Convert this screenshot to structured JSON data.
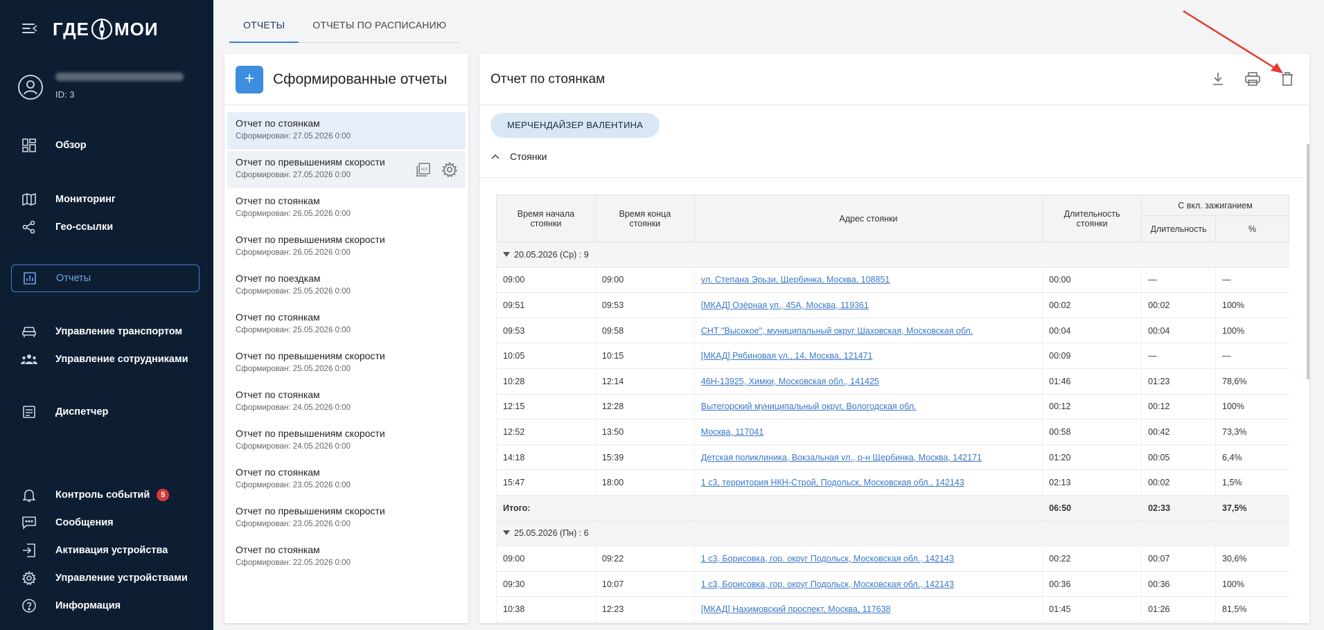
{
  "sidebar": {
    "logo": {
      "left": "ГДЕ",
      "right": "МОИ"
    },
    "user_id": "ID: 3",
    "nav": [
      {
        "label": "Обзор",
        "icon": "dashboard-icon"
      },
      {
        "label": "Мониторинг",
        "icon": "map-icon"
      },
      {
        "label": "Гео-ссылки",
        "icon": "share-icon"
      },
      {
        "label": "Отчеты",
        "icon": "chart-icon"
      },
      {
        "label": "Управление транспортом",
        "icon": "car-icon"
      },
      {
        "label": "Управление сотрудниками",
        "icon": "people-icon"
      },
      {
        "label": "Диспетчер",
        "icon": "dispatcher-icon"
      },
      {
        "label": "Контроль событий",
        "icon": "bell-icon",
        "badge": "5"
      },
      {
        "label": "Сообщения",
        "icon": "message-icon"
      },
      {
        "label": "Активация устройства",
        "icon": "login-icon"
      },
      {
        "label": "Управление устройствами",
        "icon": "gear-icon"
      },
      {
        "label": "Информация",
        "icon": "help-icon"
      }
    ]
  },
  "tabs": [
    {
      "label": "ОТЧЕТЫ"
    },
    {
      "label": "ОТЧЕТЫ ПО РАСПИСАНИЮ"
    }
  ],
  "list": {
    "add_label": "+",
    "title": "Сформированные отчеты",
    "items": [
      {
        "name": "Отчет по стоянкам",
        "date": "Сформирован: 27.05.2026 0:00"
      },
      {
        "name": "Отчет по превышениям скорости",
        "date": "Сформирован: 27.05.2026 0:00"
      },
      {
        "name": "Отчет по стоянкам",
        "date": "Сформирован: 26.05.2026 0:00"
      },
      {
        "name": "Отчет по превышениям скорости",
        "date": "Сформирован: 26.05.2026 0:00"
      },
      {
        "name": "Отчет по поездкам",
        "date": "Сформирован: 25.05.2026 0:00"
      },
      {
        "name": "Отчет по стоянкам",
        "date": "Сформирован: 25.05.2026 0:00"
      },
      {
        "name": "Отчет по превышениям скорости",
        "date": "Сформирован: 25.05.2026 0:00"
      },
      {
        "name": "Отчет по стоянкам",
        "date": "Сформирован: 24.05.2026 0:00"
      },
      {
        "name": "Отчет по превышениям скорости",
        "date": "Сформирован: 24.05.2026 0:00"
      },
      {
        "name": "Отчет по стоянкам",
        "date": "Сформирован: 23.05.2026 0:00"
      },
      {
        "name": "Отчет по превышениям скорости",
        "date": "Сформирован: 23.05.2026 0:00"
      },
      {
        "name": "Отчет по стоянкам",
        "date": "Сформирован: 22.05.2026 0:00"
      }
    ]
  },
  "detail": {
    "title": "Отчет по стоянкам",
    "chip": "МЕРЧЕНДАЙЗЕР ВАЛЕНТИНА",
    "section": "Стоянки",
    "headers": {
      "start": "Время начала стоянки",
      "end": "Время конца стоянки",
      "address": "Адрес стоянки",
      "duration": "Длительность стоянки",
      "ignition_group": "С вкл. зажиганием",
      "ign_duration": "Длительность",
      "ign_pct": "%"
    },
    "groups": [
      {
        "label": "20.05.2026 (Ср) : 9",
        "rows": [
          [
            "09:00",
            "09:00",
            "ул. Степана Эрьзи, Щербинка, Москва, 108851",
            "00:00",
            "—",
            "—"
          ],
          [
            "09:51",
            "09:53",
            "[МКАД] Озёрная ул., 45А, Москва, 119361",
            "00:02",
            "00:02",
            "100%"
          ],
          [
            "09:53",
            "09:58",
            "СНТ \"Высокое\", муниципальный округ Шаховская, Московская обл.",
            "00:04",
            "00:04",
            "100%"
          ],
          [
            "10:05",
            "10:15",
            "[МКАД] Рябиновая ул., 14, Москва, 121471",
            "00:09",
            "—",
            "—"
          ],
          [
            "10:28",
            "12:14",
            "46Н-13925, Химки, Московская обл., 141425",
            "01:46",
            "01:23",
            "78,6%"
          ],
          [
            "12:15",
            "12:28",
            "Вытегорский муниципальный округ, Вологодская обл.",
            "00:12",
            "00:12",
            "100%"
          ],
          [
            "12:52",
            "13:50",
            "Москва, 117041",
            "00:58",
            "00:42",
            "73,3%"
          ],
          [
            "14:18",
            "15:39",
            "Детская поликлиника, Вокзальная ул., р-н Щербинка, Москва, 142171",
            "01:20",
            "00:05",
            "6,4%"
          ],
          [
            "15:47",
            "18:00",
            "1 с3, территория НКН-Строй, Подольск, Московская обл., 142143",
            "02:13",
            "00:02",
            "1,5%"
          ]
        ],
        "total": {
          "label": "Итого:",
          "duration": "06:50",
          "ign_duration": "02:33",
          "ign_pct": "37,5%"
        }
      },
      {
        "label": "25.05.2026 (Пн) : 6",
        "rows": [
          [
            "09:00",
            "09:22",
            "1 с3, Борисовка, гор. округ Подольск, Московская обл., 142143",
            "00:22",
            "00:07",
            "30,6%"
          ],
          [
            "09:30",
            "10:07",
            "1 с3, Борисовка, гор. округ Подольск, Московская обл., 142143",
            "00:36",
            "00:36",
            "100%"
          ],
          [
            "10:38",
            "12:23",
            "[МКАД] Нахимовский проспект, Москва, 117638",
            "01:45",
            "01:26",
            "81,5%"
          ]
        ]
      }
    ]
  },
  "colors": {
    "sidebar_bg": "#0d1e33",
    "accent": "#3d8ee0",
    "link": "#3a78c9",
    "annotation": "#e8382f"
  }
}
